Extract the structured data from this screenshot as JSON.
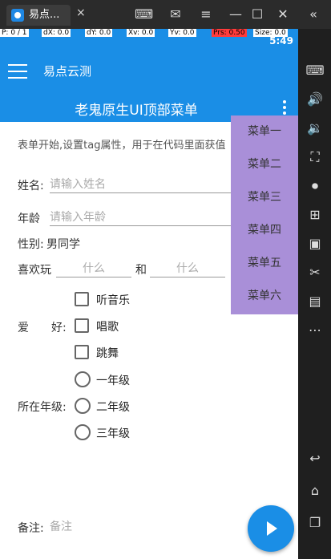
{
  "window": {
    "tab_title": "易点...",
    "tab_close": "×",
    "controls": [
      "gamepad-icon",
      "mail-icon",
      "menu-icon",
      "minimize-icon",
      "maximize-icon",
      "close-icon"
    ]
  },
  "debug": {
    "p": "P: 0 / 1",
    "dx": "dX: 0.0",
    "dy": "dY: 0.0",
    "xv": "Xv: 0.0",
    "yv": "Yv: 0.0",
    "prs": "Prs: 0.50",
    "size": "Size: 0.0"
  },
  "status": {
    "time": "5:49"
  },
  "app": {
    "name": "易点云测",
    "page_title": "老鬼原生UI顶部菜单"
  },
  "form": {
    "intro": "表单开始,设置tag属性，用于在代码里面获值",
    "name_label": "姓名:",
    "name_placeholder": "请输入姓名",
    "age_label": "年龄",
    "age_placeholder": "请输入年龄",
    "gender_label": "性别:",
    "gender_value": "男同学",
    "likes_label": "喜欢玩",
    "likes_placeholder_1": "什么",
    "likes_and": "和",
    "likes_placeholder_2": "什么",
    "hobby_label": "爱　　好:",
    "hobbies": [
      "听音乐",
      "唱歌",
      "跳舞"
    ],
    "grade_label": "所在年级:",
    "grades": [
      "一年级",
      "二年级",
      "三年级"
    ],
    "note_label": "备注:",
    "note_placeholder": "备注"
  },
  "menu": {
    "items": [
      "菜单一",
      "菜单二",
      "菜单三",
      "菜单四",
      "菜单五",
      "菜单六"
    ],
    "color": "#a98fd8"
  },
  "colors": {
    "primary": "#1a8ee6"
  }
}
